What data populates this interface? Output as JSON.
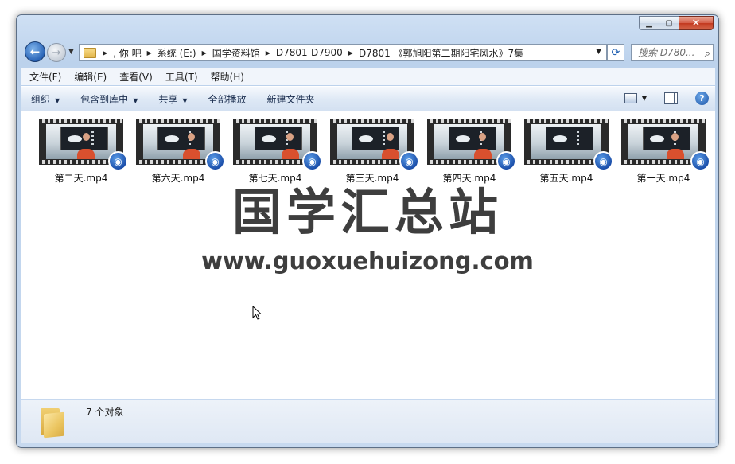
{
  "address": {
    "crumbs": [
      ", 你   吧",
      "系统 (E:)",
      "国学资料馆",
      "D7801-D7900",
      "D7801 《郭旭阳第二期阳宅风水》7集"
    ]
  },
  "search": {
    "placeholder": "搜索 D780..."
  },
  "menubar": {
    "items": [
      "文件(F)",
      "编辑(E)",
      "查看(V)",
      "工具(T)",
      "帮助(H)"
    ]
  },
  "commandbar": {
    "organize": "组织",
    "include_library": "包含到库中",
    "share": "共享",
    "play_all": "全部播放",
    "new_folder": "新建文件夹"
  },
  "files": [
    {
      "name": "第二天.mp4"
    },
    {
      "name": "第六天.mp4"
    },
    {
      "name": "第七天.mp4"
    },
    {
      "name": "第三天.mp4"
    },
    {
      "name": "第四天.mp4"
    },
    {
      "name": "第五天.mp4"
    },
    {
      "name": "第一天.mp4"
    }
  ],
  "watermark": {
    "title": "国学汇总站",
    "url": "www.guoxuehuizong.com"
  },
  "details": {
    "count": "7 个对象"
  },
  "icons": {
    "back": "back-arrow-icon",
    "forward": "forward-arrow-icon",
    "refresh": "refresh-icon",
    "search": "search-icon",
    "views": "views-icon",
    "preview_pane": "preview-pane-icon",
    "help": "help-icon",
    "folder": "folder-icon",
    "video": "video-badge-icon"
  },
  "colors": {
    "accent": "#1d55a7",
    "window_frame": "#bcd2ec"
  }
}
